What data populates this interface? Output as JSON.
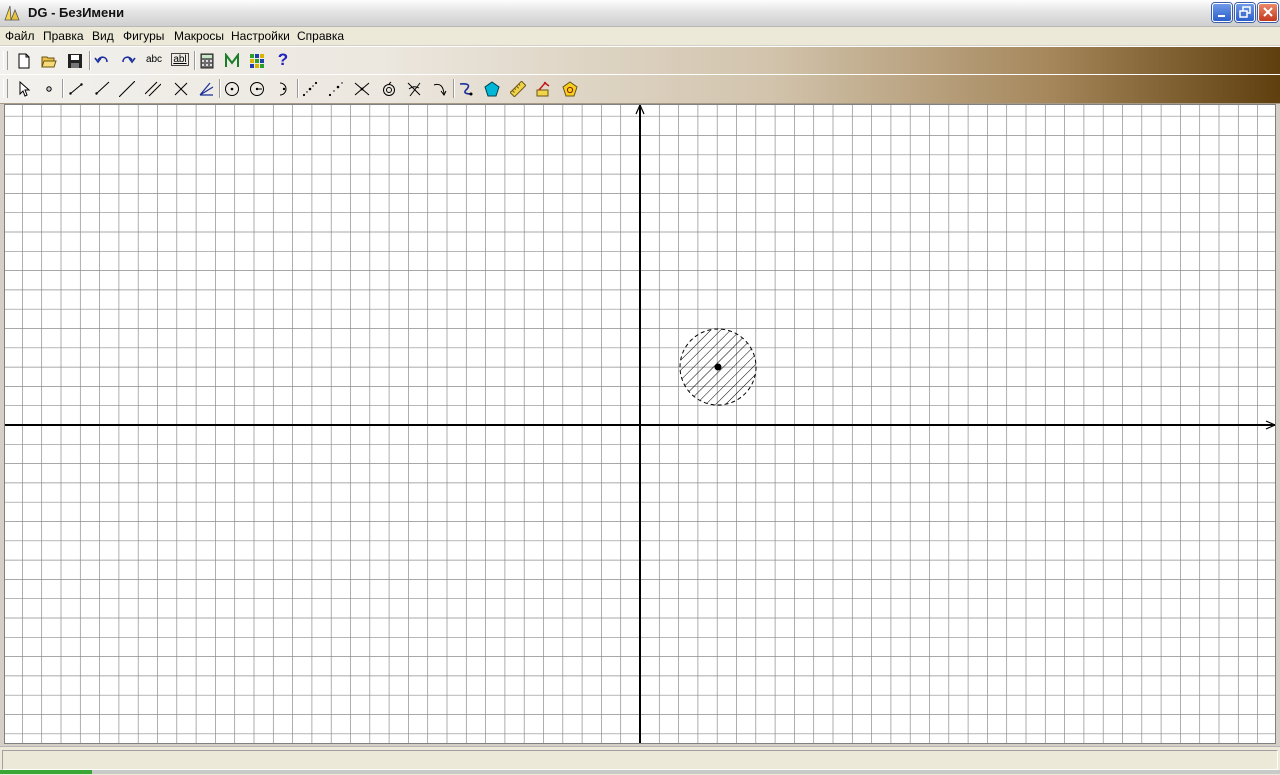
{
  "window": {
    "title": "DG - БезИмени",
    "controls": [
      "minimize-icon",
      "restore-icon",
      "close-icon"
    ]
  },
  "menu": {
    "items": [
      "Файл",
      "Правка",
      "Вид",
      "Фигуры",
      "Макросы",
      "Настройки",
      "Справка"
    ]
  },
  "toolbar_main": {
    "buttons": [
      "new-file-icon",
      "open-folder-icon",
      "save-icon",
      "undo-icon",
      "redo-icon",
      "label-text-icon",
      "edit-text-icon",
      "calculator-icon",
      "macro-m-icon",
      "color-grid-icon",
      "help-icon"
    ],
    "label_button_text": "abc",
    "edit_button_text": "abl",
    "help_glyph": "?"
  },
  "toolbar_tools": {
    "buttons": [
      "select-arrow-icon",
      "point-icon",
      "segment-icon",
      "ray-icon",
      "line-icon",
      "parallel-icon",
      "perpendicular-icon",
      "bisector-icon",
      "circle-icon",
      "circle-radius-icon",
      "arc-icon",
      "midpoint-icon",
      "point-on-object-icon",
      "intersection-icon",
      "compass-icon",
      "reflect-icon",
      "turn-icon",
      "trace-icon",
      "polygon-icon",
      "measure-icon",
      "animation-icon",
      "pentagon-tool-icon"
    ]
  },
  "drawing": {
    "coordinate_axes": true,
    "grid": true,
    "objects": [
      {
        "type": "circle",
        "style": "dashed-hatched",
        "center_point": true
      }
    ]
  },
  "colors": {
    "toolbar_gradient_end": "#5f3f0e",
    "grid_line": "#8c8c8c",
    "axis": "#000000",
    "polygon_tool": "#00b7d8",
    "help": "#2020c0"
  }
}
